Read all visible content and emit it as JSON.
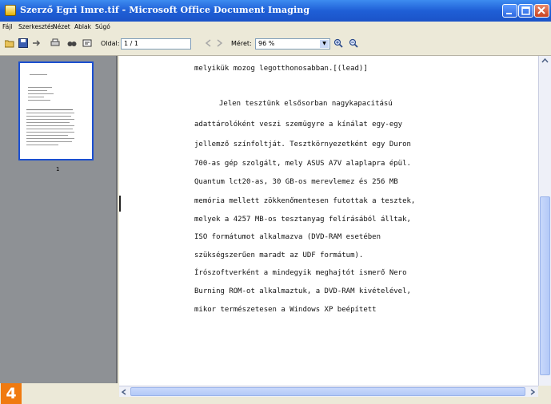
{
  "window": {
    "title": "Szerző Egri Imre.tif - Microsoft Office Document Imaging"
  },
  "menubar": {
    "items": [
      "Fájl",
      "Szerkesztés",
      "Nézet",
      "Ablak",
      "Súgó"
    ]
  },
  "toolbar": {
    "page_label": "Oldal:",
    "page_value": "1 / 1",
    "zoom_label": "Méret:",
    "zoom_value": "96 %"
  },
  "thumbnail": {
    "page_number": "1"
  },
  "document": {
    "lines": [
      "melyikük mozog legotthonosabban.[(lead)]",
      "Jelen tesztünk elsősorban nagykapacitású",
      "adattárolóként veszi szemügyre a kínálat egy-egy",
      "jellemző színfoltját. Tesztkörnyezetként egy Duron",
      "700-as gép szolgált, mely ASUS A7V alaplapra épül.",
      "Quantum lct20-as, 30 GB-os merevlemez és 256 MB",
      "memória mellett zökkenőmentesen futottak a tesztek,",
      "melyek a 4257 MB-os tesztanyag felírásából álltak,",
      "ISO formátumot alkalmazva (DVD-RAM esetében",
      "szükségszerűen maradt az UDF formátum).",
      "Írószoftverként a mindegyik meghajtót ismerő Nero",
      "Burning ROM-ot alkalmaztuk, a DVD-RAM kivételével,",
      "mikor természetesen a Windows XP beépített"
    ]
  },
  "badge": {
    "number": "4"
  },
  "colors": {
    "titlebar": "#1f5fd6",
    "thumbnail_pane": "#8e9195",
    "badge": "#f07a10"
  }
}
